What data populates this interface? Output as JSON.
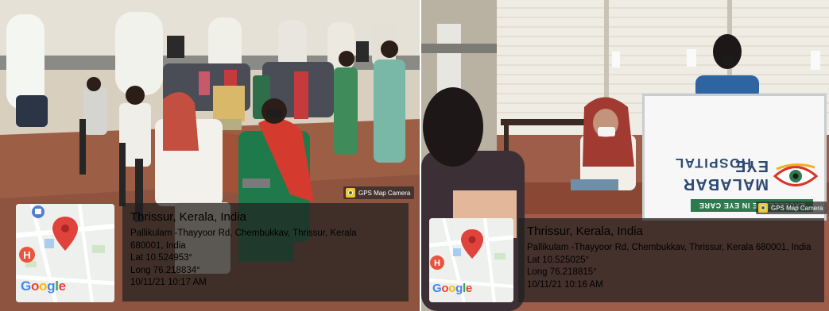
{
  "photos": [
    {
      "badge": "GPS Map Camera",
      "city": "Thrissur, Kerala, India",
      "address_line1": "Pallikulam -Thayyoor Rd, Chembukkav, Thrissur, Kerala",
      "address_line2": "680001, India",
      "lat": "Lat 10.524953°",
      "long": "Long 76.218834°",
      "datetime": "10/11/21 10:17 AM",
      "map_logo": "Google"
    },
    {
      "badge": "GPS Map Camera",
      "city": "Thrissur, Kerala, India",
      "address_line1": "Pallikulam -Thayyoor Rd, Chembukkav, Thrissur, Kerala 680001, India",
      "lat": "Lat 10.525025°",
      "long": "Long 76.218815°",
      "datetime": "10/11/21 10:16 AM",
      "map_logo": "Google"
    }
  ],
  "signboard": {
    "brand": "MALABAR EYE",
    "subtitle": "HOSPITAL",
    "tagline": "EXCELLENCE IN EYE CARE"
  },
  "colors": {
    "map_pin": "#e0433b",
    "hospital_marker": "#e8553f",
    "google_blue": "#4285f4",
    "google_red": "#ea4335",
    "google_yellow": "#fbbc05",
    "google_green": "#34a853"
  }
}
